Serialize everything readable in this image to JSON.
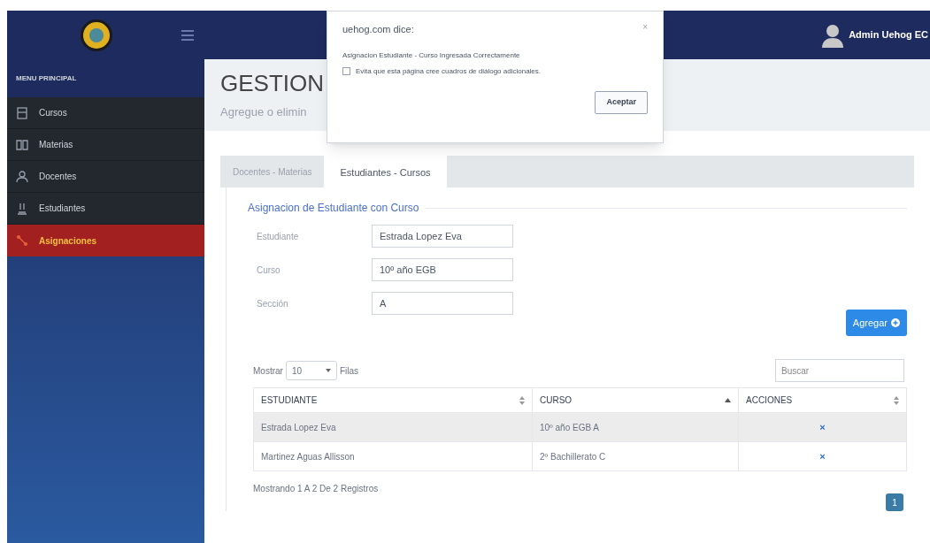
{
  "header": {
    "user": "Admin Uehog EC"
  },
  "sidebar": {
    "title": "MENU PRINCIPAL",
    "items": [
      {
        "label": "Cursos",
        "selected": false
      },
      {
        "label": "Materias",
        "selected": false
      },
      {
        "label": "Docentes",
        "selected": false
      },
      {
        "label": "Estudiantes",
        "selected": false
      },
      {
        "label": "Asignaciones",
        "selected": true
      }
    ]
  },
  "page": {
    "title": "GESTION",
    "subtitle": "Agregue o elimin"
  },
  "dialog": {
    "title": "uehog.com dice:",
    "close": "×",
    "message": "Asignacion Estudiante - Curso Ingresada Correctamente",
    "checkbox": {
      "label": "Evita que esta página cree cuadros de diálogo adicionales.",
      "checked": false
    },
    "button": "Aceptar"
  },
  "tabs": [
    {
      "label": "Docentes - Materias",
      "selected": false
    },
    {
      "label": "Estudiantes - Cursos",
      "selected": true
    }
  ],
  "form": {
    "legend": "Asignacion de Estudiante con Curso",
    "fields": [
      {
        "label": "Estudiante",
        "value": "Estrada Lopez Eva"
      },
      {
        "label": "Curso",
        "value": "10º año EGB"
      },
      {
        "label": "Sección",
        "value": "A"
      }
    ],
    "button": "Agregar"
  },
  "table": {
    "show_label": "Mostrar",
    "page_size": "10",
    "rows_label": "Filas",
    "search": {
      "placeholder": "Buscar"
    },
    "columns": [
      {
        "label": "ESTUDIANTE",
        "sorted": false
      },
      {
        "label": "CURSO",
        "sorted": true
      },
      {
        "label": "ACCIONES",
        "sorted": false
      }
    ],
    "rows": [
      {
        "cells": [
          "Estrada Lopez Eva",
          "10º año EGB A"
        ],
        "action": "×",
        "highlighted": true
      },
      {
        "cells": [
          "Martinez Aguas Allisson",
          "2º Bachillerato C"
        ],
        "action": "×",
        "highlighted": false
      }
    ],
    "info": "Mostrando 1 A 2 De 2 Registros",
    "pages": [
      {
        "label": "1",
        "selected": true
      }
    ]
  }
}
